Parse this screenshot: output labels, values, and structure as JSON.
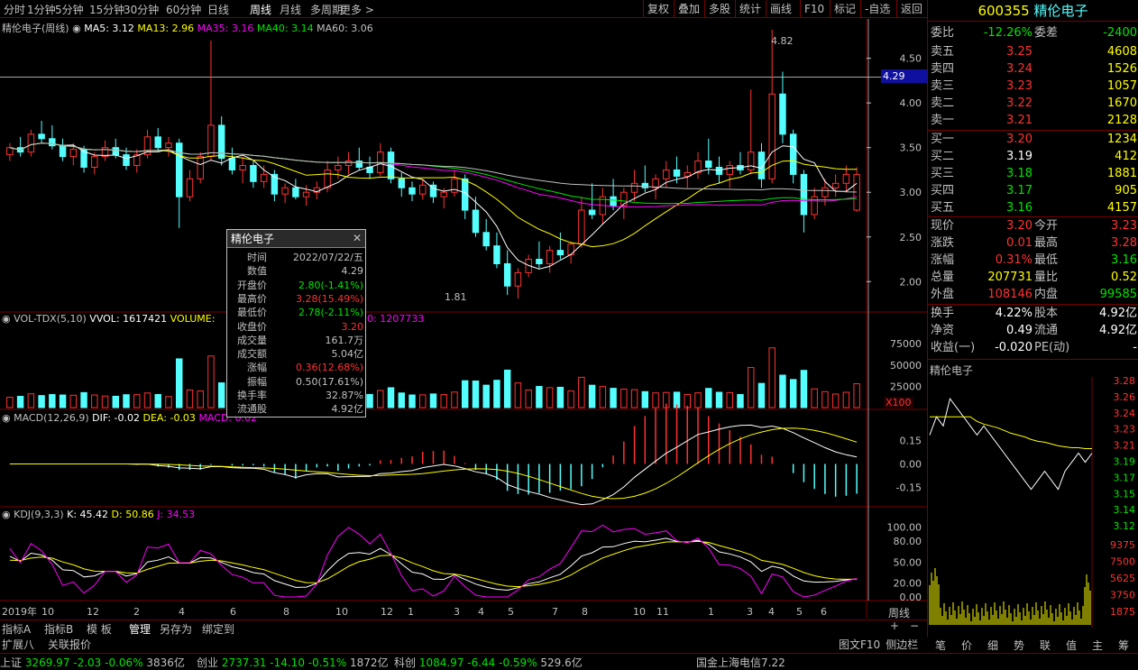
{
  "toolbar": {
    "periods": [
      "分时",
      "1分钟",
      "5分钟",
      "15分钟",
      "30分钟",
      "60分钟",
      "日线",
      "周线",
      "月线",
      "多周期",
      "更多 >"
    ],
    "active_period": "周线",
    "right_buttons": [
      "复权",
      "叠加",
      "多股",
      "统计",
      "画线",
      "F10",
      "标记",
      "-自选",
      "返回"
    ]
  },
  "main_legend": {
    "name": "精伦电子(周线)",
    "ma5": "MA5: 3.12",
    "ma13": "MA13: 2.96",
    "ma35": "MA35: 3.16",
    "ma40": "MA40: 3.14",
    "ma60": "MA60: 3.06"
  },
  "vol_legend": {
    "label": "VOL-TDX(5,10)",
    "vvol": "VVOL: 1617421",
    "volume": "VOLUME:",
    "tail": "0: 1207733"
  },
  "macd_legend": {
    "label": "MACD(12,26,9)",
    "dif": "DIF: -0.02",
    "dea": "DEA: -0.03",
    "macd": "MACD: 0.02"
  },
  "kdj_legend": {
    "label": "KDJ(9,3,3)",
    "k": "K: 45.42",
    "d": "D: 50.86",
    "j": "J: 34.53"
  },
  "price_axis": [
    "4.50",
    "4.00",
    "3.50",
    "3.00",
    "2.50",
    "2.00"
  ],
  "crosshair_price": "4.29",
  "vol_axis": [
    "75000",
    "50000",
    "25000"
  ],
  "vol_unit": "X100",
  "macd_axis": [
    "0.15",
    "0.00",
    "-0.15"
  ],
  "kdj_axis": [
    "100.00",
    "80.00",
    "50.00",
    "20.00",
    "0.00"
  ],
  "period_label": "周线",
  "time_axis": [
    "2019年",
    "10",
    "12",
    "2",
    "4",
    "6",
    "8",
    "10",
    "12",
    "1",
    "3",
    "4",
    "5",
    "7",
    "8",
    "10",
    "11",
    "1",
    "3",
    "4",
    "5",
    "6"
  ],
  "annotations": {
    "high": "4.82",
    "low": "1.81"
  },
  "tooltip": {
    "title": "精伦电子",
    "rows": [
      {
        "k": "时间",
        "v": "2022/07/22/五",
        "c": "#c0c0c0"
      },
      {
        "k": "数值",
        "v": "4.29",
        "c": "#c0c0c0"
      },
      {
        "k": "开盘价",
        "v": "2.80(-1.41%)",
        "c": "#00e600"
      },
      {
        "k": "最高价",
        "v": "3.28(15.49%)",
        "c": "#ff3232"
      },
      {
        "k": "最低价",
        "v": "2.78(-2.11%)",
        "c": "#00e600"
      },
      {
        "k": "收盘价",
        "v": "3.20",
        "c": "#ff3232"
      },
      {
        "k": "成交量",
        "v": "161.7万",
        "c": "#c0c0c0"
      },
      {
        "k": "成交额",
        "v": "5.04亿",
        "c": "#c0c0c0"
      },
      {
        "k": "涨幅",
        "v": "0.36(12.68%)",
        "c": "#ff3232"
      },
      {
        "k": "振幅",
        "v": "0.50(17.61%)",
        "c": "#c0c0c0"
      },
      {
        "k": "换手率",
        "v": "32.87%",
        "c": "#c0c0c0"
      },
      {
        "k": "流通股",
        "v": "4.92亿",
        "c": "#c0c0c0"
      }
    ]
  },
  "tabs_bottom": [
    "指标A",
    "指标B",
    "模 板",
    "管理",
    "另存为",
    "绑定到"
  ],
  "tabs_bottom2": [
    "扩展八",
    "关联报价"
  ],
  "right_panel": {
    "code": "600355",
    "name": "精伦电子",
    "weibi_label": "委比",
    "weibi": "-12.26%",
    "weicha_label": "委差",
    "weicha": "-2400",
    "sells": [
      {
        "label": "卖五",
        "price": "3.25",
        "vol": "4608"
      },
      {
        "label": "卖四",
        "price": "3.24",
        "vol": "1526"
      },
      {
        "label": "卖三",
        "price": "3.23",
        "vol": "1057"
      },
      {
        "label": "卖二",
        "price": "3.22",
        "vol": "1670"
      },
      {
        "label": "卖一",
        "price": "3.21",
        "vol": "2128"
      }
    ],
    "buys": [
      {
        "label": "买一",
        "price": "3.20",
        "vol": "1234",
        "pc": "#ff3232"
      },
      {
        "label": "买二",
        "price": "3.19",
        "vol": "412",
        "pc": "#ffffff"
      },
      {
        "label": "买三",
        "price": "3.18",
        "vol": "1881",
        "pc": "#00e600"
      },
      {
        "label": "买四",
        "price": "3.17",
        "vol": "905",
        "pc": "#00e600"
      },
      {
        "label": "买五",
        "price": "3.16",
        "vol": "4157",
        "pc": "#00e600"
      }
    ],
    "stats": [
      {
        "l1": "现价",
        "v1": "3.20",
        "c1": "#ff3232",
        "l2": "今开",
        "v2": "3.23",
        "c2": "#ff3232"
      },
      {
        "l1": "涨跌",
        "v1": "0.01",
        "c1": "#ff3232",
        "l2": "最高",
        "v2": "3.28",
        "c2": "#ff3232"
      },
      {
        "l1": "涨幅",
        "v1": "0.31%",
        "c1": "#ff3232",
        "l2": "最低",
        "v2": "3.16",
        "c2": "#00e600"
      },
      {
        "l1": "总量",
        "v1": "207731",
        "c1": "#ffff00",
        "l2": "量比",
        "v2": "0.52",
        "c2": "#ffff00"
      },
      {
        "l1": "外盘",
        "v1": "108146",
        "c1": "#ff3232",
        "l2": "内盘",
        "v2": "99585",
        "c2": "#00e600"
      }
    ],
    "stats2": [
      {
        "l1": "换手",
        "v1": "4.22%",
        "l2": "股本",
        "v2": "4.92亿"
      },
      {
        "l1": "净资",
        "v1": "0.49",
        "l2": "流通",
        "v2": "4.92亿"
      },
      {
        "l1": "收益(一)",
        "v1": "-0.020",
        "l2": "PE(动)",
        "v2": "-"
      }
    ],
    "mini_title": "精伦电子",
    "mini_axis": [
      "3.28",
      "3.26",
      "3.24",
      "3.23",
      "3.21",
      "3.19",
      "3.17",
      "3.15",
      "3.14",
      "3.12"
    ],
    "mini_vol_axis": [
      "9375",
      "7500",
      "5625",
      "3750",
      "1875"
    ],
    "bottom_tabs": [
      "笔",
      "价",
      "细",
      "势",
      "联",
      "值",
      "主",
      "筹"
    ]
  },
  "status_bar": {
    "items": [
      {
        "name": "上证",
        "value": "3269.97",
        "chg": "-2.03",
        "pct": "-0.06%",
        "amt": "3836亿"
      },
      {
        "name": "创业",
        "value": "2737.31",
        "chg": "-14.10",
        "pct": "-0.51%",
        "amt": "1872亿"
      },
      {
        "name": "科创",
        "value": "1084.97",
        "chg": "-6.44",
        "pct": "-0.59%",
        "amt": "529.6亿"
      }
    ],
    "broker": "国金上海电信7.22",
    "right_links": [
      "图文F10",
      "侧边栏"
    ]
  },
  "chart_data": {
    "type": "candlestick",
    "title": "精伦电子(周线)",
    "ylim": [
      1.7,
      4.9
    ],
    "candles_note": "weekly OHLC estimated",
    "candles": [
      [
        3.42,
        3.55,
        3.35,
        3.5
      ],
      [
        3.5,
        3.62,
        3.4,
        3.45
      ],
      [
        3.45,
        3.7,
        3.4,
        3.65
      ],
      [
        3.65,
        3.8,
        3.55,
        3.6
      ],
      [
        3.6,
        3.75,
        3.48,
        3.52
      ],
      [
        3.52,
        3.6,
        3.35,
        3.4
      ],
      [
        3.4,
        3.55,
        3.3,
        3.48
      ],
      [
        3.48,
        3.52,
        3.22,
        3.28
      ],
      [
        3.28,
        3.45,
        3.2,
        3.4
      ],
      [
        3.4,
        3.58,
        3.35,
        3.5
      ],
      [
        3.5,
        3.6,
        3.38,
        3.42
      ],
      [
        3.42,
        3.5,
        3.25,
        3.3
      ],
      [
        3.3,
        3.48,
        3.22,
        3.42
      ],
      [
        3.42,
        3.7,
        3.38,
        3.62
      ],
      [
        3.62,
        3.72,
        3.45,
        3.5
      ],
      [
        3.5,
        3.62,
        3.4,
        3.55
      ],
      [
        3.55,
        3.6,
        2.6,
        2.95
      ],
      [
        2.95,
        3.25,
        2.9,
        3.15
      ],
      [
        3.15,
        3.45,
        3.1,
        3.4
      ],
      [
        3.4,
        4.7,
        3.35,
        3.75
      ],
      [
        3.75,
        3.85,
        3.3,
        3.38
      ],
      [
        3.38,
        3.5,
        3.2,
        3.25
      ],
      [
        3.25,
        3.4,
        3.1,
        3.3
      ],
      [
        3.3,
        3.35,
        3.05,
        3.12
      ],
      [
        3.12,
        3.3,
        3.05,
        3.2
      ],
      [
        3.2,
        3.25,
        2.9,
        2.98
      ],
      [
        2.98,
        3.1,
        2.88,
        3.05
      ],
      [
        3.05,
        3.15,
        2.92,
        2.95
      ],
      [
        2.95,
        3.08,
        2.85,
        3.0
      ],
      [
        3.0,
        3.12,
        2.92,
        3.05
      ],
      [
        3.05,
        3.35,
        3.0,
        3.25
      ],
      [
        3.25,
        3.4,
        3.15,
        3.3
      ],
      [
        3.3,
        3.45,
        3.2,
        3.35
      ],
      [
        3.35,
        3.5,
        3.25,
        3.28
      ],
      [
        3.28,
        3.4,
        3.15,
        3.22
      ],
      [
        3.22,
        3.55,
        3.18,
        3.45
      ],
      [
        3.45,
        3.5,
        3.1,
        3.15
      ],
      [
        3.15,
        3.22,
        2.95,
        3.05
      ],
      [
        3.05,
        3.12,
        2.9,
        2.98
      ],
      [
        2.98,
        3.15,
        2.92,
        3.08
      ],
      [
        3.08,
        3.12,
        2.88,
        2.95
      ],
      [
        2.95,
        3.05,
        2.82,
        3.0
      ],
      [
        3.0,
        3.25,
        2.95,
        3.15
      ],
      [
        3.15,
        3.2,
        2.7,
        2.8
      ],
      [
        2.8,
        2.95,
        2.5,
        2.55
      ],
      [
        2.55,
        2.7,
        2.35,
        2.4
      ],
      [
        2.4,
        2.55,
        2.15,
        2.2
      ],
      [
        2.2,
        2.35,
        1.85,
        1.95
      ],
      [
        1.95,
        2.15,
        1.81,
        2.1
      ],
      [
        2.1,
        2.3,
        2.05,
        2.25
      ],
      [
        2.25,
        2.45,
        2.15,
        2.2
      ],
      [
        2.2,
        2.4,
        2.1,
        2.35
      ],
      [
        2.35,
        2.55,
        2.25,
        2.3
      ],
      [
        2.3,
        2.45,
        2.2,
        2.42
      ],
      [
        2.42,
        2.95,
        2.38,
        2.8
      ],
      [
        2.8,
        3.1,
        2.7,
        2.75
      ],
      [
        2.75,
        3.05,
        2.65,
        2.95
      ],
      [
        2.95,
        3.15,
        2.8,
        2.85
      ],
      [
        2.85,
        3.05,
        2.7,
        3.0
      ],
      [
        3.0,
        3.25,
        2.9,
        3.1
      ],
      [
        3.1,
        3.3,
        3.0,
        3.05
      ],
      [
        3.05,
        3.2,
        2.92,
        3.15
      ],
      [
        3.15,
        3.35,
        3.05,
        3.25
      ],
      [
        3.25,
        3.4,
        3.1,
        3.18
      ],
      [
        3.18,
        3.3,
        3.05,
        3.22
      ],
      [
        3.22,
        3.45,
        3.15,
        3.35
      ],
      [
        3.35,
        3.6,
        3.2,
        3.28
      ],
      [
        3.28,
        3.4,
        3.1,
        3.2
      ],
      [
        3.2,
        3.35,
        3.05,
        3.3
      ],
      [
        3.3,
        3.45,
        3.2,
        3.25
      ],
      [
        3.25,
        4.15,
        3.2,
        3.45
      ],
      [
        3.45,
        3.55,
        3.05,
        3.15
      ],
      [
        3.15,
        4.82,
        3.1,
        4.1
      ],
      [
        4.1,
        4.35,
        3.55,
        3.65
      ],
      [
        3.65,
        3.7,
        3.1,
        3.2
      ],
      [
        3.2,
        3.25,
        2.55,
        2.75
      ],
      [
        2.75,
        3.05,
        2.7,
        2.95
      ],
      [
        2.95,
        3.15,
        2.85,
        3.05
      ],
      [
        3.05,
        3.2,
        2.95,
        3.1
      ],
      [
        3.1,
        3.3,
        3.0,
        3.2
      ],
      [
        2.8,
        3.28,
        2.78,
        3.2
      ]
    ],
    "volume_ylim": [
      0,
      90000
    ],
    "macd_ylim": [
      -0.25,
      0.25
    ],
    "kdj_ylim": [
      0,
      110
    ]
  }
}
